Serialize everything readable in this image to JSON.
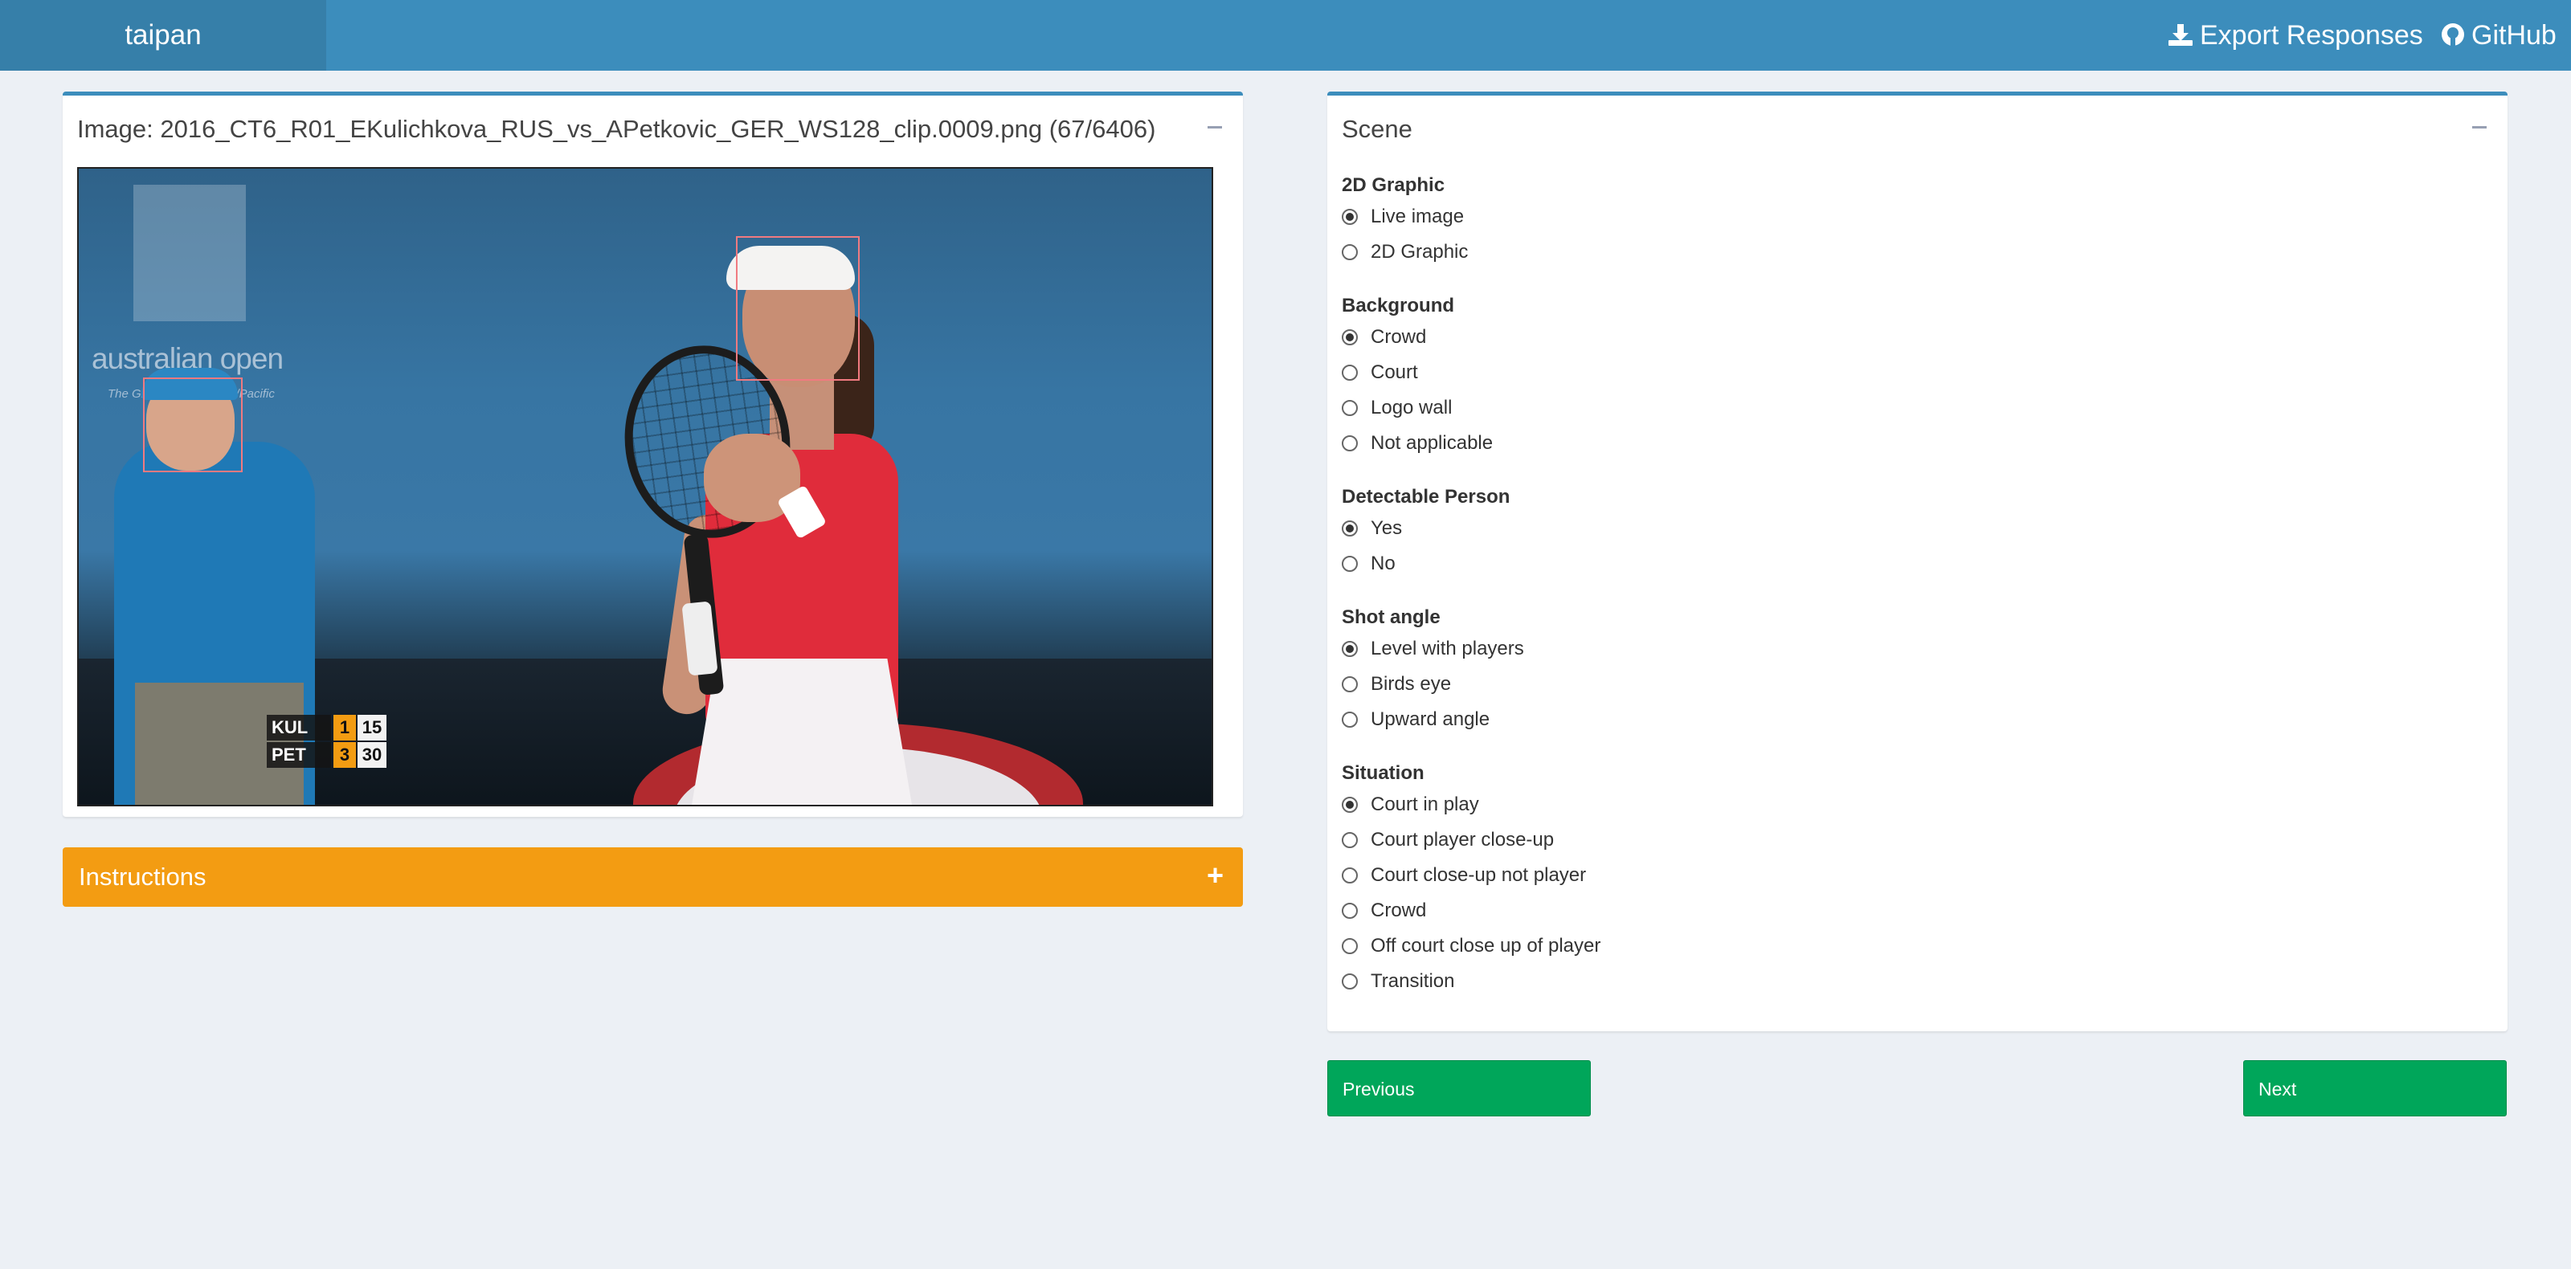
{
  "header": {
    "logo": "taipan",
    "export_label": "Export Responses",
    "github_label": "GitHub",
    "color": "#3c8dbc"
  },
  "image_box": {
    "title": "Image: 2016_CT6_R01_EKulichkova_RUS_vs_APetkovic_GER_WS128_clip.0009.png (67/6406)",
    "watermark_text": "australian open",
    "watermark_sub": "The Grand Slam of Asia/Pacific",
    "scoreboard": [
      {
        "name": "KUL",
        "set": "1",
        "points": "15"
      },
      {
        "name": "PET",
        "set": "3",
        "points": "30"
      }
    ]
  },
  "instructions": {
    "title": "Instructions",
    "toggle": "+",
    "color": "#f39c12"
  },
  "scene": {
    "title": "Scene",
    "questions": [
      {
        "label": "2D Graphic",
        "options": [
          "Live image",
          "2D Graphic"
        ],
        "selected": "Live image"
      },
      {
        "label": "Background",
        "options": [
          "Crowd",
          "Court",
          "Logo wall",
          "Not applicable"
        ],
        "selected": "Crowd"
      },
      {
        "label": "Detectable Person",
        "options": [
          "Yes",
          "No"
        ],
        "selected": "Yes"
      },
      {
        "label": "Shot angle",
        "options": [
          "Level with players",
          "Birds eye",
          "Upward angle"
        ],
        "selected": "Level with players"
      },
      {
        "label": "Situation",
        "options": [
          "Court in play",
          "Court player close-up",
          "Court close-up not player",
          "Crowd",
          "Off court close up of player",
          "Transition"
        ],
        "selected": "Court in play"
      }
    ]
  },
  "nav": {
    "previous_label": "Previous",
    "next_label": "Next",
    "button_color": "#00a65a"
  }
}
